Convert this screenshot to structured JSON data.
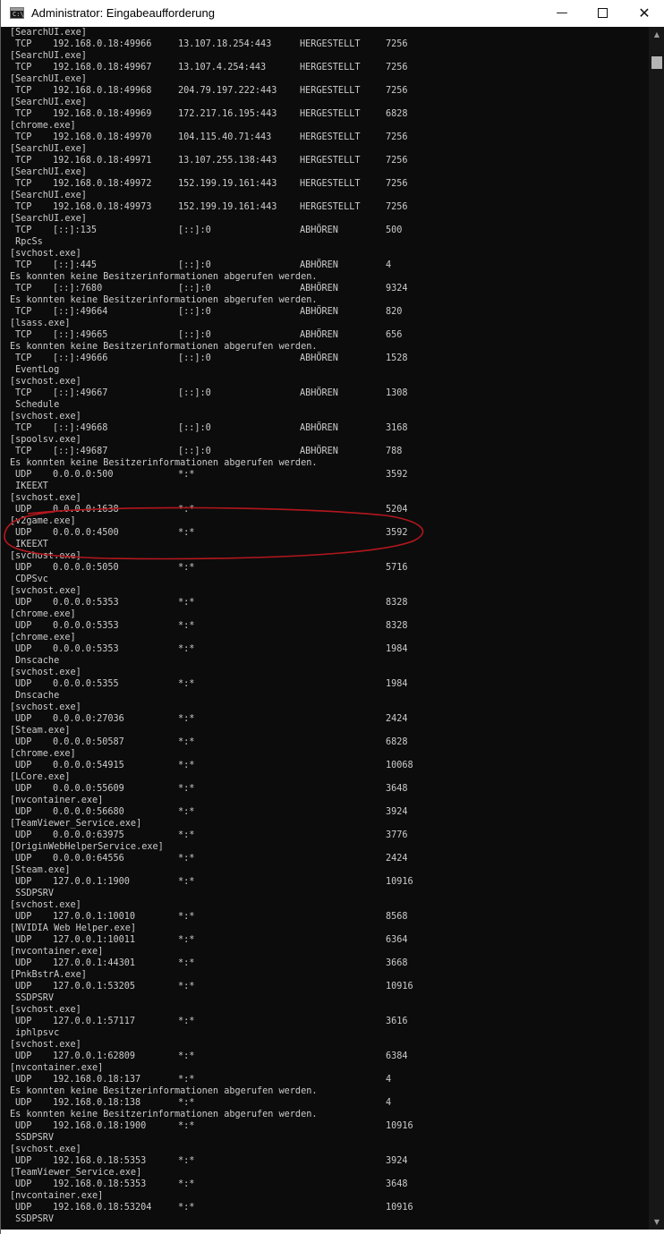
{
  "window": {
    "title": "Administrator: Eingabeaufforderung",
    "icon_text": "C:\\",
    "controls": {
      "minimize": "—",
      "close": "✕"
    }
  },
  "colors": {
    "console_bg": "#0c0c0c",
    "console_text": "#cccccc",
    "annotation": "#b3171d"
  },
  "annotation": {
    "type": "hand-drawn-ellipse",
    "color": "#b3171d"
  },
  "lines": [
    [
      "[SearchUI.exe]"
    ],
    [
      "TCP",
      "192.168.0.18:49966",
      "13.107.18.254:443",
      "HERGESTELLT",
      "7256"
    ],
    [
      "[SearchUI.exe]"
    ],
    [
      "TCP",
      "192.168.0.18:49967",
      "13.107.4.254:443",
      "HERGESTELLT",
      "7256"
    ],
    [
      "[SearchUI.exe]"
    ],
    [
      "TCP",
      "192.168.0.18:49968",
      "204.79.197.222:443",
      "HERGESTELLT",
      "7256"
    ],
    [
      "[SearchUI.exe]"
    ],
    [
      "TCP",
      "192.168.0.18:49969",
      "172.217.16.195:443",
      "HERGESTELLT",
      "6828"
    ],
    [
      "[chrome.exe]"
    ],
    [
      "TCP",
      "192.168.0.18:49970",
      "104.115.40.71:443",
      "HERGESTELLT",
      "7256"
    ],
    [
      "[SearchUI.exe]"
    ],
    [
      "TCP",
      "192.168.0.18:49971",
      "13.107.255.138:443",
      "HERGESTELLT",
      "7256"
    ],
    [
      "[SearchUI.exe]"
    ],
    [
      "TCP",
      "192.168.0.18:49972",
      "152.199.19.161:443",
      "HERGESTELLT",
      "7256"
    ],
    [
      "[SearchUI.exe]"
    ],
    [
      "TCP",
      "192.168.0.18:49973",
      "152.199.19.161:443",
      "HERGESTELLT",
      "7256"
    ],
    [
      "[SearchUI.exe]"
    ],
    [
      "TCP",
      "[::]:135",
      "[::]:0",
      "ABHÖREN",
      "500"
    ],
    [
      " RpcSs"
    ],
    [
      "[svchost.exe]"
    ],
    [
      "TCP",
      "[::]:445",
      "[::]:0",
      "ABHÖREN",
      "4"
    ],
    [
      "Es konnten keine Besitzerinformationen abgerufen werden."
    ],
    [
      "TCP",
      "[::]:7680",
      "[::]:0",
      "ABHÖREN",
      "9324"
    ],
    [
      "Es konnten keine Besitzerinformationen abgerufen werden."
    ],
    [
      "TCP",
      "[::]:49664",
      "[::]:0",
      "ABHÖREN",
      "820"
    ],
    [
      "[lsass.exe]"
    ],
    [
      "TCP",
      "[::]:49665",
      "[::]:0",
      "ABHÖREN",
      "656"
    ],
    [
      "Es konnten keine Besitzerinformationen abgerufen werden."
    ],
    [
      "TCP",
      "[::]:49666",
      "[::]:0",
      "ABHÖREN",
      "1528"
    ],
    [
      " EventLog"
    ],
    [
      "[svchost.exe]"
    ],
    [
      "TCP",
      "[::]:49667",
      "[::]:0",
      "ABHÖREN",
      "1308"
    ],
    [
      " Schedule"
    ],
    [
      "[svchost.exe]"
    ],
    [
      "TCP",
      "[::]:49668",
      "[::]:0",
      "ABHÖREN",
      "3168"
    ],
    [
      "[spoolsv.exe]"
    ],
    [
      "TCP",
      "[::]:49687",
      "[::]:0",
      "ABHÖREN",
      "788"
    ],
    [
      "Es konnten keine Besitzerinformationen abgerufen werden."
    ],
    [
      "UDP",
      "0.0.0.0:500",
      "*:*",
      "",
      "3592"
    ],
    [
      " IKEEXT"
    ],
    [
      "[svchost.exe]"
    ],
    [
      "UDP",
      "0.0.0.0:1638",
      "*:*",
      "",
      "5204"
    ],
    [
      "[v2game.exe]"
    ],
    [
      "UDP",
      "0.0.0.0:4500",
      "*:*",
      "",
      "3592"
    ],
    [
      " IKEEXT"
    ],
    [
      "[svchost.exe]"
    ],
    [
      "UDP",
      "0.0.0.0:5050",
      "*:*",
      "",
      "5716"
    ],
    [
      " CDPSvc"
    ],
    [
      "[svchost.exe]"
    ],
    [
      "UDP",
      "0.0.0.0:5353",
      "*:*",
      "",
      "8328"
    ],
    [
      "[chrome.exe]"
    ],
    [
      "UDP",
      "0.0.0.0:5353",
      "*:*",
      "",
      "8328"
    ],
    [
      "[chrome.exe]"
    ],
    [
      "UDP",
      "0.0.0.0:5353",
      "*:*",
      "",
      "1984"
    ],
    [
      " Dnscache"
    ],
    [
      "[svchost.exe]"
    ],
    [
      "UDP",
      "0.0.0.0:5355",
      "*:*",
      "",
      "1984"
    ],
    [
      " Dnscache"
    ],
    [
      "[svchost.exe]"
    ],
    [
      "UDP",
      "0.0.0.0:27036",
      "*:*",
      "",
      "2424"
    ],
    [
      "[Steam.exe]"
    ],
    [
      "UDP",
      "0.0.0.0:50587",
      "*:*",
      "",
      "6828"
    ],
    [
      "[chrome.exe]"
    ],
    [
      "UDP",
      "0.0.0.0:54915",
      "*:*",
      "",
      "10068"
    ],
    [
      "[LCore.exe]"
    ],
    [
      "UDP",
      "0.0.0.0:55609",
      "*:*",
      "",
      "3648"
    ],
    [
      "[nvcontainer.exe]"
    ],
    [
      "UDP",
      "0.0.0.0:56680",
      "*:*",
      "",
      "3924"
    ],
    [
      "[TeamViewer_Service.exe]"
    ],
    [
      "UDP",
      "0.0.0.0:63975",
      "*:*",
      "",
      "3776"
    ],
    [
      "[OriginWebHelperService.exe]"
    ],
    [
      "UDP",
      "0.0.0.0:64556",
      "*:*",
      "",
      "2424"
    ],
    [
      "[Steam.exe]"
    ],
    [
      "UDP",
      "127.0.0.1:1900",
      "*:*",
      "",
      "10916"
    ],
    [
      " SSDPSRV"
    ],
    [
      "[svchost.exe]"
    ],
    [
      "UDP",
      "127.0.0.1:10010",
      "*:*",
      "",
      "8568"
    ],
    [
      "[NVIDIA Web Helper.exe]"
    ],
    [
      "UDP",
      "127.0.0.1:10011",
      "*:*",
      "",
      "6364"
    ],
    [
      "[nvcontainer.exe]"
    ],
    [
      "UDP",
      "127.0.0.1:44301",
      "*:*",
      "",
      "3668"
    ],
    [
      "[PnkBstrA.exe]"
    ],
    [
      "UDP",
      "127.0.0.1:53205",
      "*:*",
      "",
      "10916"
    ],
    [
      " SSDPSRV"
    ],
    [
      "[svchost.exe]"
    ],
    [
      "UDP",
      "127.0.0.1:57117",
      "*:*",
      "",
      "3616"
    ],
    [
      " iphlpsvc"
    ],
    [
      "[svchost.exe]"
    ],
    [
      "UDP",
      "127.0.0.1:62809",
      "*:*",
      "",
      "6384"
    ],
    [
      "[nvcontainer.exe]"
    ],
    [
      "UDP",
      "192.168.0.18:137",
      "*:*",
      "",
      "4"
    ],
    [
      "Es konnten keine Besitzerinformationen abgerufen werden."
    ],
    [
      "UDP",
      "192.168.0.18:138",
      "*:*",
      "",
      "4"
    ],
    [
      "Es konnten keine Besitzerinformationen abgerufen werden."
    ],
    [
      "UDP",
      "192.168.0.18:1900",
      "*:*",
      "",
      "10916"
    ],
    [
      " SSDPSRV"
    ],
    [
      "[svchost.exe]"
    ],
    [
      "UDP",
      "192.168.0.18:5353",
      "*:*",
      "",
      "3924"
    ],
    [
      "[TeamViewer_Service.exe]"
    ],
    [
      "UDP",
      "192.168.0.18:5353",
      "*:*",
      "",
      "3648"
    ],
    [
      "[nvcontainer.exe]"
    ],
    [
      "UDP",
      "192.168.0.18:53204",
      "*:*",
      "",
      "10916"
    ],
    [
      " SSDPSRV"
    ]
  ]
}
